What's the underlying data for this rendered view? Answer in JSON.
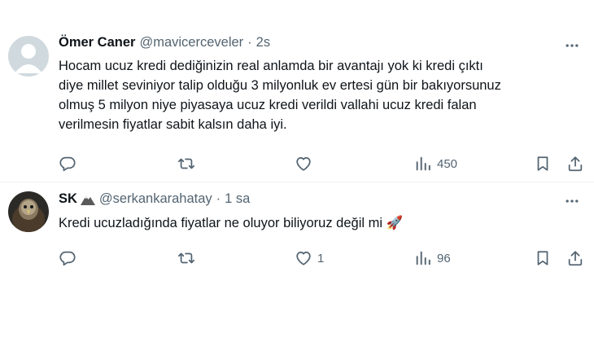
{
  "tweets": [
    {
      "name": "Ömer Caner",
      "handle": "@mavicerceveler",
      "separator": "·",
      "time": "2s",
      "text_lines": [
        "Hocam ucuz kredi dediğinizin real anlamda bir avantajı yok ki kredi çıktı",
        "diye millet seviniyor talip olduğu 3 milyonluk ev ertesi gün bir bakıyorsunuz",
        "olmuş 5 milyon niye piyasaya ucuz kredi verildi vallahi ucuz kredi falan",
        "verilmesin fiyatlar sabit kalsın daha iyi."
      ],
      "likes": "",
      "views": "450",
      "avatar": "default-avatar"
    },
    {
      "name": "SK",
      "handle": "@serkankarahatay",
      "separator": "·",
      "time": "1 sa",
      "text": "Kredi ucuzladığında fiyatlar ne oluyor biliyoruz değil mi",
      "emoji": "🚀",
      "likes": "1",
      "views": "96",
      "avatar": "eagle-avatar",
      "badge": "mountain-emoji"
    }
  ],
  "icons": [
    "reply-icon",
    "retweet-icon",
    "like-icon",
    "views-icon",
    "bookmark-icon",
    "share-icon",
    "more-icon"
  ],
  "colors": {
    "text": "#0f1419",
    "secondary": "#536471",
    "divider": "#eff3f4",
    "background": "#ffffff"
  }
}
